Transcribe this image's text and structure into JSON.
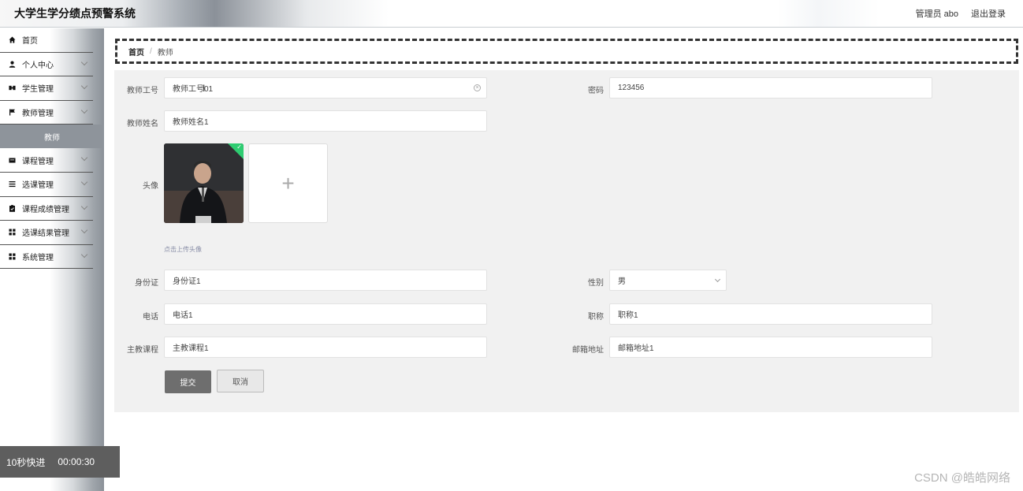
{
  "header": {
    "app_title": "大学生学分绩点预警系统",
    "user_label": "管理员 abo",
    "logout_label": "退出登录"
  },
  "sidebar": {
    "items": [
      {
        "label": "首页",
        "icon": "home-icon",
        "has_chevron": false
      },
      {
        "label": "个人中心",
        "icon": "user-icon",
        "has_chevron": true
      },
      {
        "label": "学生管理",
        "icon": "students-icon",
        "has_chevron": true
      },
      {
        "label": "教师管理",
        "icon": "flag-icon",
        "has_chevron": true
      },
      {
        "label": "课程管理",
        "icon": "card-icon",
        "has_chevron": true
      },
      {
        "label": "选课管理",
        "icon": "list-icon",
        "has_chevron": true
      },
      {
        "label": "课程成绩管理",
        "icon": "clipboard-icon",
        "has_chevron": true
      },
      {
        "label": "选课结果管理",
        "icon": "grid-icon",
        "has_chevron": true
      },
      {
        "label": "系统管理",
        "icon": "grid-icon",
        "has_chevron": true
      }
    ],
    "active_submenu": "教师"
  },
  "breadcrumb": {
    "home": "首页",
    "separator": "/",
    "current": "教师"
  },
  "form": {
    "teacher_id": {
      "label": "教师工号",
      "value": "教师工号01"
    },
    "password": {
      "label": "密码",
      "value": "123456"
    },
    "teacher_name": {
      "label": "教师姓名",
      "value": "教师姓名1"
    },
    "avatar": {
      "label": "头像",
      "upload_hint": "点击上传头像",
      "plus": "+"
    },
    "id_card": {
      "label": "身份证",
      "value": "身份证1"
    },
    "gender": {
      "label": "性别",
      "value": "男"
    },
    "phone": {
      "label": "电话",
      "value": "电话1"
    },
    "title": {
      "label": "职称",
      "value": "职称1"
    },
    "main_course": {
      "label": "主教课程",
      "value": "主教课程1"
    },
    "email": {
      "label": "邮箱地址",
      "value": "邮箱地址1"
    },
    "submit_label": "提交",
    "cancel_label": "取消"
  },
  "player": {
    "fast_forward_label": "10秒快进",
    "time": "00:00:30"
  },
  "watermark": "CSDN @皓皓网络",
  "colors": {
    "sidebar_active_bg": "#8e949b",
    "submit_bg": "#6e6e6e",
    "panel_bg": "#f1f1f1",
    "avatar_check": "#2ecc71"
  }
}
